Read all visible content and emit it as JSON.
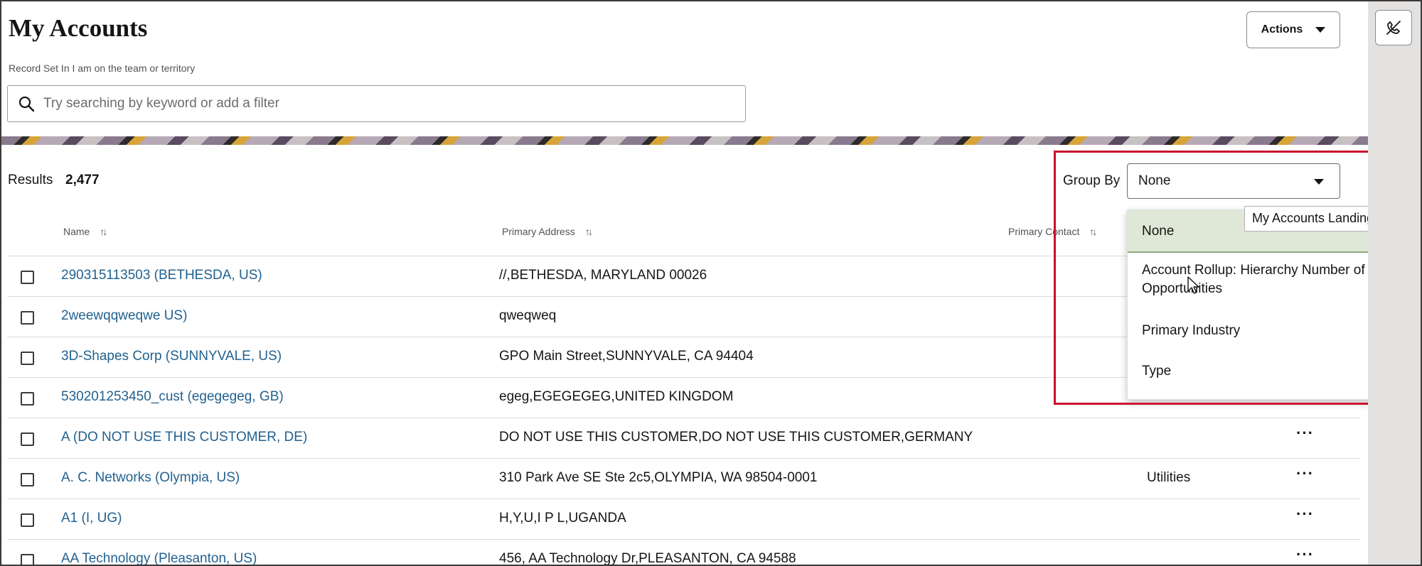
{
  "page": {
    "title": "My Accounts",
    "record_set": "Record Set In I am on the team or territory",
    "actions_label": "Actions"
  },
  "search": {
    "placeholder": "Try searching by keyword or add a filter"
  },
  "results": {
    "label": "Results",
    "count": "2,477"
  },
  "group_by": {
    "label": "Group By",
    "value": "None",
    "options": [
      "None",
      "Account Rollup: Hierarchy Number of Open Opportunities",
      "Primary Industry",
      "Type"
    ],
    "tooltip": "My Accounts Landing Page"
  },
  "table": {
    "columns": [
      "Name",
      "Primary Address",
      "Primary Contact"
    ],
    "rows": [
      {
        "name": "290315113503 (BETHESDA, US)",
        "address": "//,BETHESDA, MARYLAND 00026",
        "industry": ""
      },
      {
        "name": "2weewqqweqwe US)",
        "address": "qweqweq",
        "industry": ""
      },
      {
        "name": "3D-Shapes Corp (SUNNYVALE, US)",
        "address": "GPO Main Street,SUNNYVALE, CA 94404",
        "industry": ""
      },
      {
        "name": "530201253450_cust (egegegeg, GB)",
        "address": "egeg,EGEGEGEG,UNITED KINGDOM",
        "industry": ""
      },
      {
        "name": "A (DO NOT USE THIS CUSTOMER, DE)",
        "address": "DO NOT USE THIS CUSTOMER,DO NOT USE THIS CUSTOMER,GERMANY",
        "industry": ""
      },
      {
        "name": "A. C. Networks (Olympia, US)",
        "address": "310 Park Ave SE Ste 2c5,OLYMPIA, WA 98504-0001",
        "industry": "Utilities"
      },
      {
        "name": "A1 (I, UG)",
        "address": "H,Y,U,I P L,UGANDA",
        "industry": ""
      },
      {
        "name": "AA Technology (Pleasanton, US)",
        "address": "456, AA Technology Dr,PLEASANTON, CA 94588",
        "industry": ""
      }
    ],
    "more_label": "···"
  },
  "colors": {
    "link": "#22618f",
    "highlight": "#c8102e",
    "selected_option": "#dfe7d6"
  },
  "icons": {
    "search": "search-icon",
    "sort": "sort-icon",
    "rail": "phone-off-icon",
    "caret": "caret-down-icon"
  }
}
